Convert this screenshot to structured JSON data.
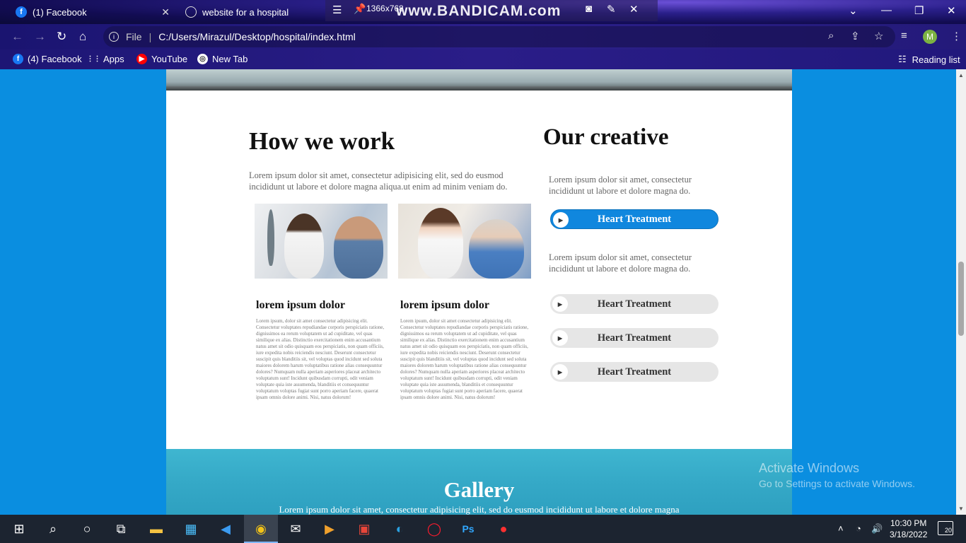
{
  "browser": {
    "tabs": [
      {
        "label": "(1) Facebook"
      },
      {
        "label": "website for a hospital"
      }
    ],
    "recorder": {
      "watermark": "www.BANDICAM.com",
      "resolution": "1366x768"
    },
    "address": {
      "scheme": "File",
      "url": "C:/Users/Mirazul/Desktop/hospital/index.html"
    },
    "profile_initial": "M",
    "bookmarks": [
      {
        "label": "(4) Facebook"
      },
      {
        "label": "Apps"
      },
      {
        "label": "YouTube"
      },
      {
        "label": "New Tab"
      }
    ],
    "reading_list": "Reading list"
  },
  "page": {
    "how": {
      "title": "How we work",
      "text": "Lorem ipsum dolor sit amet, consectetur adipisicing elit, sed do eusmod incididunt ut labore et dolore magna aliqua.ut enim ad minim veniam do.",
      "cards": [
        {
          "title": "lorem ipsum dolor",
          "text": "Lorem ipsum, dolor sit amet consectetur adipisicing elit. Consectetur voluptates repudiandae corporis perspiciatis ratione, dignissimos ea rerum voluptatem ut ad cupiditate, vel quas similique ex alias. Distinctio exercitationem enim accusantium natus amet sit odio quisquam eos perspiciatis, non quam officiis, iure expedita nobis reiciendis nesciunt. Deserunt consectetur suscipit quis blanditiis sit, vel voluptas quod incidunt sed soluta maiores dolorem harum voluptatibus ratione alias consequuntur dolores? Numquam nulla aperiam asperiores placeat architecto voluptatum sunt! Incidunt quibusdam corrupti, odit veniam voluptate quia iste assumenda, blanditiis et consequuntur voluptatum voluptas fugiat sunt porro aperiam facere, quaerat ipsam omnis dolore animi. Nisi, natus dolorum!"
        },
        {
          "title": "lorem ipsum dolor",
          "text": "Lorem ipsum, dolor sit amet consectetur adipisicing elit. Consectetur voluptates repudiandae corporis perspiciatis ratione, dignissimos ea rerum voluptatem ut ad cupiditate, vel quas similique ex alias. Distinctio exercitationem enim accusantium natus amet sit odio quisquam eos perspiciatis, non quam officiis, iure expedita nobis reiciendis nesciunt. Deserunt consectetur suscipit quis blanditiis sit, vel voluptas quod incidunt sed soluta maiores dolorem harum voluptatibus ratione alias consequuntur dolores? Numquam nulla aperiam asperiores placeat architecto voluptatum sunt! Incidunt quibusdam corrupti, odit veniam voluptate quia iste assumenda, blanditiis et consequuntur voluptatum voluptas fugiat sunt porro aperiam facere, quaerat ipsam omnis dolore animi. Nisi, natus dolorum!"
        }
      ]
    },
    "creative": {
      "title": "Our creative",
      "text1": "Lorem ipsum dolor sit amet, consectetur incididunt ut labore et dolore magna do.",
      "text2": "Lorem ipsum dolor sit amet, consectetur incididunt ut labore et dolore magna do.",
      "buttons": [
        {
          "label": "Heart Treatment",
          "active": true
        },
        {
          "label": "Heart Treatment",
          "active": false
        },
        {
          "label": "Heart Treatment",
          "active": false
        },
        {
          "label": "Heart Treatment",
          "active": false
        }
      ]
    },
    "gallery": {
      "title": "Gallery",
      "text": "Lorem ipsum dolor sit amet, consectetur adipisicing elit, sed do eusmod incididunt ut labore et dolore magna"
    }
  },
  "os": {
    "activation": {
      "line1": "Activate Windows",
      "line2": "Go to Settings to activate Windows."
    },
    "clock": {
      "time": "10:30 PM",
      "date": "3/18/2022"
    },
    "notifications": "20"
  },
  "colors": {
    "accent": "#1087de",
    "page_bg": "#0a8ee0"
  }
}
